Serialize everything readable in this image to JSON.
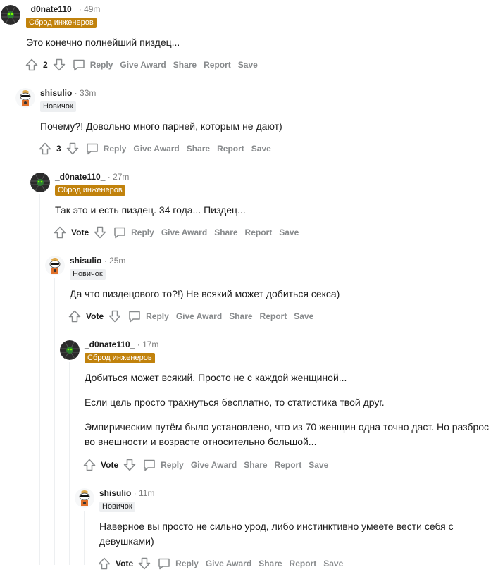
{
  "icons": {
    "upvote": "arrow-up-icon",
    "downvote": "arrow-down-icon",
    "reply": "speech-bubble-icon"
  },
  "colors": {
    "engineer_flair_bg": "#c1820c",
    "newbie_flair_bg": "#edeff1",
    "action_text": "#878a8c"
  },
  "labels": {
    "reply": "Reply",
    "give_award": "Give Award",
    "share": "Share",
    "report": "Report",
    "save": "Save",
    "vote": "Vote"
  },
  "comments": [
    {
      "author": "_d0nate110_",
      "time": "49m",
      "flair": "Сброд инженеров",
      "lines": [
        "Это конечно полнейший пиздец..."
      ],
      "score": "2"
    },
    {
      "author": "shisulio",
      "time": "33m",
      "flair": "Новичок",
      "lines": [
        "Почему?! Довольно много парней, которым не дают)"
      ],
      "score": "3"
    },
    {
      "author": "_d0nate110_",
      "time": "27m",
      "flair": "Сброд инженеров",
      "lines": [
        "Так это и есть пиздец. 34 года... Пиздец..."
      ],
      "score": "Vote"
    },
    {
      "author": "shisulio",
      "time": "25m",
      "flair": "Новичок",
      "lines": [
        "Да что пиздецового то?!) Не всякий может добиться секса)"
      ],
      "score": "Vote"
    },
    {
      "author": "_d0nate110_",
      "time": "17m",
      "flair": "Сброд инженеров",
      "lines": [
        "Добиться может всякий. Просто не с каждой женщиной...",
        "Если цель просто трахнуться бесплатно, то статистика твой друг.",
        "Эмпирическим путём было установлено, что из 70 женщин одна точно даст. Но разброс",
        "во внешности и возрасте относительно большой..."
      ],
      "score": "Vote"
    },
    {
      "author": "shisulio",
      "time": "11m",
      "flair": "Новичок",
      "lines": [
        "Наверное вы просто не сильно урод, либо инстинктивно умеете вести себя с",
        "девушками)"
      ],
      "score": "Vote"
    }
  ]
}
